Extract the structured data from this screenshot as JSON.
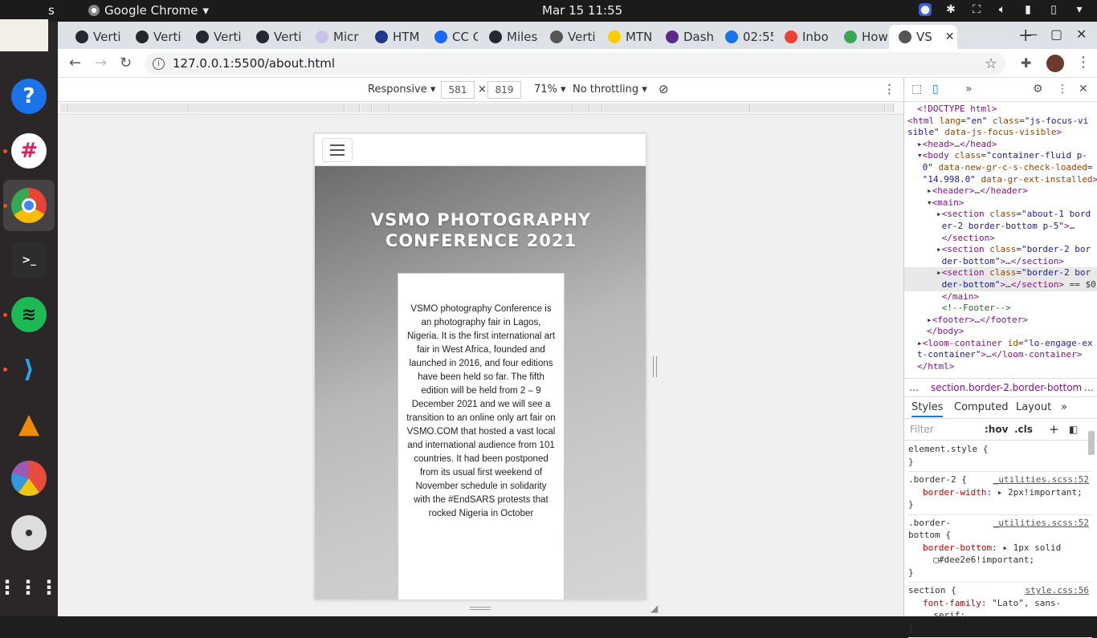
{
  "topbar": {
    "activities_fragment": "s",
    "app_name": "Google Chrome",
    "clock": "Mar 15  11:55"
  },
  "browser": {
    "tabs": [
      {
        "label": "Verti",
        "icon": "github-icon"
      },
      {
        "label": "Verti",
        "icon": "github-icon"
      },
      {
        "label": "Verti",
        "icon": "github-icon"
      },
      {
        "label": "Verti",
        "icon": "github-icon"
      },
      {
        "label": "Micr",
        "icon": "microverse-icon"
      },
      {
        "label": "HTM",
        "icon": "user-icon"
      },
      {
        "label": "CC G",
        "icon": "behance-icon"
      },
      {
        "label": "Miles",
        "icon": "github-icon"
      },
      {
        "label": "Verti",
        "icon": "globe-icon"
      },
      {
        "label": "MTN",
        "icon": "mtn-icon"
      },
      {
        "label": "Dash",
        "icon": "dash-icon"
      },
      {
        "label": "02:55",
        "icon": "clock-icon"
      },
      {
        "label": "Inbo",
        "icon": "gmail-icon"
      },
      {
        "label": "How",
        "icon": "howto-icon"
      },
      {
        "label": "VS",
        "icon": "globe-icon"
      }
    ],
    "url": "127.0.0.1:5500/about.html"
  },
  "device_toolbar": {
    "mode": "Responsive",
    "width": "581",
    "height": "819",
    "times": "×",
    "zoom": "71%",
    "throttling": "No throttling"
  },
  "page": {
    "title": "VSMO PHOTOGRAPHY CONFERENCE 2021",
    "about_text": "VSMO photography Conference is an photography fair in Lagos, Nigeria. It is the first international art fair in West Africa, founded and launched in 2016, and four editions have been held so far. The fifth edition will be held from 2 – 9 December 2021 and we will see a transition to an online only art fair on VSMO.COM that hosted a vast local and international audience from 101 countries. It had been postponed from its usual first weekend of November schedule in solidarity with the #EndSARS protests that rocked Nigeria in October"
  },
  "devtools": {
    "dom": [
      {
        "indent": 1,
        "html": "<span class='tag'>&lt;!DOCTYPE html&gt;</span>"
      },
      {
        "indent": 0,
        "html": "<span class='tag'>&lt;html</span> <span class='an'>lang</span>=<span class='av'>\"en\"</span> <span class='an'>class</span>=<span class='av'>\"js-focus-vi</span>"
      },
      {
        "indent": 0,
        "html": "<span class='av'>sible\"</span> <span class='an'>data-js-focus-visible</span><span class='tag'>&gt;</span>"
      },
      {
        "indent": 1,
        "html": "▸<span class='tag'>&lt;head&gt;</span>…<span class='tag'>&lt;/head&gt;</span>"
      },
      {
        "indent": 1,
        "html": "▾<span class='tag'>&lt;body</span> <span class='an'>class</span>=<span class='av'>\"container-fluid p-</span>"
      },
      {
        "indent": 1,
        "html": " <span class='av'>0\"</span> <span class='an'>data-new-gr-c-s-check-loaded</span>="
      },
      {
        "indent": 1,
        "html": " <span class='av'>\"14.998.0\"</span> <span class='an'>data-gr-ext-installed</span><span class='tag'>&gt;</span>"
      },
      {
        "indent": 2,
        "html": "▸<span class='tag'>&lt;header&gt;</span>…<span class='tag'>&lt;/header&gt;</span>"
      },
      {
        "indent": 2,
        "html": "▾<span class='tag'>&lt;main&gt;</span>"
      },
      {
        "indent": 3,
        "html": "▸<span class='tag'>&lt;section</span> <span class='an'>class</span>=<span class='av'>\"about-1 bord</span>"
      },
      {
        "indent": 3,
        "html": " <span class='av'>er-2 border-bottom p-5\"</span><span class='tag'>&gt;</span>…"
      },
      {
        "indent": 3,
        "html": " <span class='tag'>&lt;/section&gt;</span>"
      },
      {
        "indent": 3,
        "html": "▸<span class='tag'>&lt;section</span> <span class='an'>class</span>=<span class='av'>\"border-2 bor</span>"
      },
      {
        "indent": 3,
        "html": " <span class='av'>der-bottom\"</span><span class='tag'>&gt;</span>…<span class='tag'>&lt;/section&gt;</span>"
      },
      {
        "indent": 3,
        "html": "▸<span class='tag'>&lt;section</span> <span class='an'>class</span>=<span class='av'>\"border-2 bor</span>",
        "selected": true
      },
      {
        "indent": 3,
        "html": " <span class='av'>der-bottom\"</span><span class='tag'>&gt;</span>…<span class='tag'>&lt;/section&gt;</span> == $0",
        "selected": true
      },
      {
        "indent": 3,
        "html": " <span class='tag'>&lt;/main&gt;</span>"
      },
      {
        "indent": 3,
        "html": " <span class='cm'>&lt;!--Footer--&gt;</span>"
      },
      {
        "indent": 2,
        "html": "▸<span class='tag'>&lt;footer&gt;</span>…<span class='tag'>&lt;/footer&gt;</span>"
      },
      {
        "indent": 2,
        "html": "<span class='tag'>&lt;/body&gt;</span>"
      },
      {
        "indent": 1,
        "html": "▸<span class='tag'>&lt;loom-container</span> <span class='an'>id</span>=<span class='av'>\"lo-engage-ex</span>"
      },
      {
        "indent": 1,
        "html": "<span class='av'>t-container\"</span><span class='tag'>&gt;</span>…<span class='tag'>&lt;/loom-container&gt;</span>"
      },
      {
        "indent": 1,
        "html": "<span class='tag'>&lt;/html&gt;</span>"
      }
    ],
    "breadcrumb_dots": "…",
    "breadcrumb": "section.border-2.border-bottom",
    "breadcrumb_more": "…",
    "tabs": [
      "Styles",
      "Computed",
      "Layout"
    ],
    "more_tabs": "»",
    "filter_placeholder": "Filter",
    "hov": ":hov",
    "cls": ".cls",
    "rules": [
      {
        "selector": "element.style {",
        "source": "",
        "props": [],
        "close": "}"
      },
      {
        "selector": ".border-2 {",
        "source": "_utilities.scss:52",
        "props": [
          "border-width: ▸ 2px!important;"
        ],
        "close": "}"
      },
      {
        "selector": ".border-\nbottom {",
        "source": "_utilities.scss:52",
        "props": [
          "border-bottom: ▸ 1px solid",
          "  ▢#dee2e6!important;"
        ],
        "close": "}"
      },
      {
        "selector": "section {",
        "source": "style.css:56",
        "props": [
          "font-family: \"Lato\", sans-",
          "  serif;"
        ],
        "close": "}"
      }
    ]
  }
}
